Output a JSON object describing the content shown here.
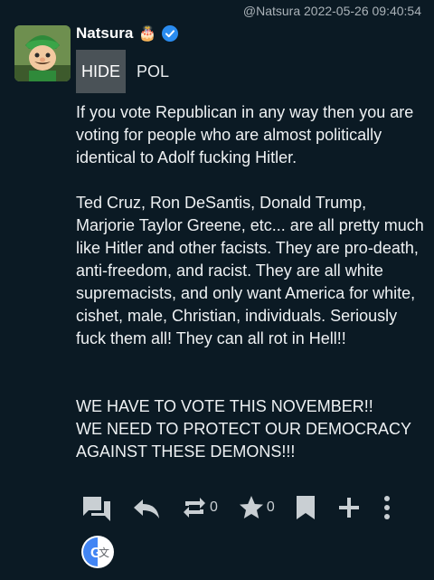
{
  "header": {
    "handle": "@Natsura",
    "timestamp": "2022-05-26 09:40:54"
  },
  "author": {
    "name": "Natsura",
    "badge_icon": "cake-emoji",
    "verified_icon": "verified-check-icon"
  },
  "tags": {
    "hide_label": "HIDE",
    "topic_label": "POL"
  },
  "post": {
    "paragraph1": "If you vote Republican in any way then you are voting for people who are almost politically identical to Adolf fucking Hitler.",
    "paragraph2": "Ted Cruz, Ron DeSantis, Donald Trump, Marjorie Taylor Greene, etc... are all pretty much like Hitler and other facists. They are pro-death, anti-freedom, and racist. They are all white supremacists, and only want America for white, cishet, male, Christian, individuals. Seriously fuck them all! They can all rot in Hell!!",
    "paragraph3_line1": "WE HAVE TO VOTE THIS NOVEMBER!!",
    "paragraph3_line2": "WE NEED TO PROTECT OUR DEMOCRACY AGAINST THESE DEMONS!!!"
  },
  "actions": {
    "boost_count": "0",
    "favourite_count": "0"
  },
  "colors": {
    "background": "#0b1a24",
    "verified": "#2a8cf0"
  }
}
